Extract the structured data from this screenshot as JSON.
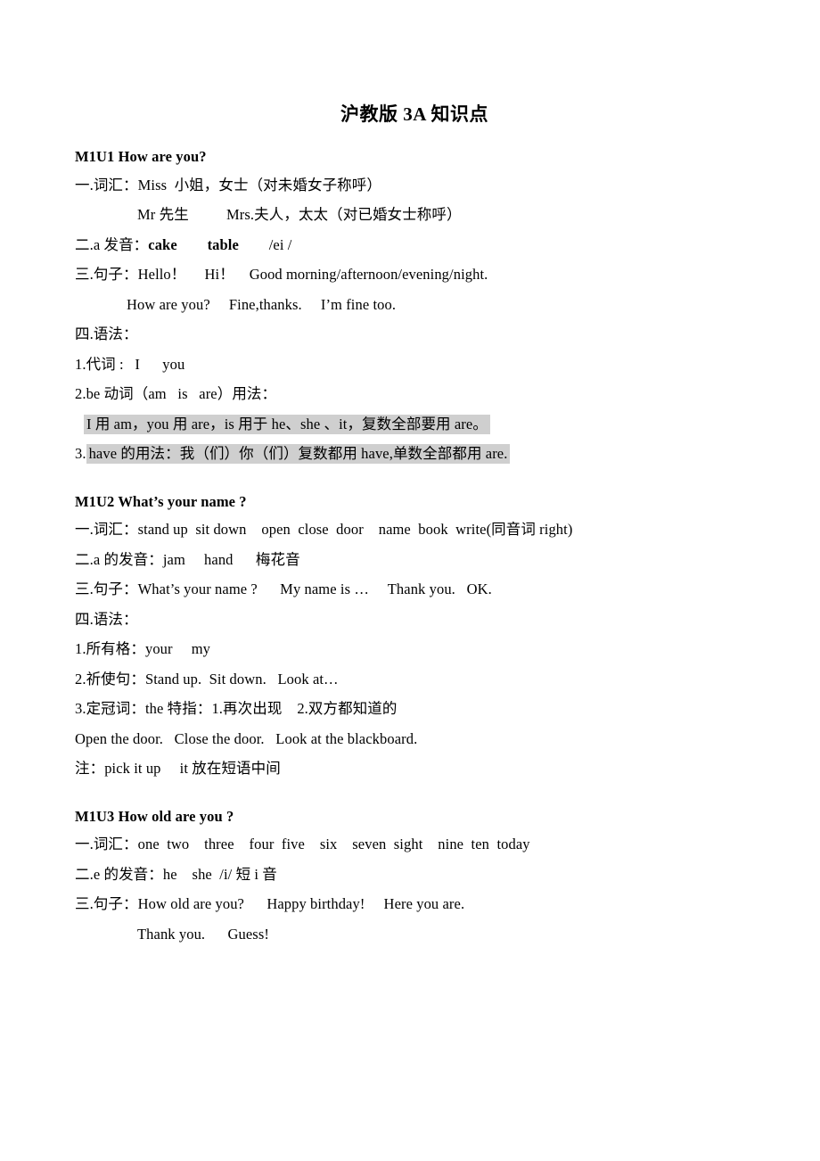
{
  "document": {
    "title": "沪教版 3A 知识点"
  },
  "sections": [
    {
      "id": "m1u1",
      "heading": "M1U1    How are you?",
      "lines": [
        {
          "id": "l1",
          "text": "一.词汇：Miss  小姐，女士（对未婚女子称呼）"
        },
        {
          "id": "l2",
          "text": "Mr 先生          Mrs.夫人，太太（对已婚女士称呼）"
        },
        {
          "id": "l3_pre",
          "text": "二.a 发音："
        },
        {
          "id": "l3_b1",
          "text": "cake"
        },
        {
          "id": "l3_mid",
          "text": "        "
        },
        {
          "id": "l3_b2",
          "text": "table"
        },
        {
          "id": "l3_end",
          "text": "        /ei /"
        },
        {
          "id": "l4",
          "text": "三.句子：Hello！     Hi！    Good morning/afternoon/evening/night."
        },
        {
          "id": "l5",
          "text": "How are you?     Fine,thanks.     I’m fine too."
        },
        {
          "id": "l6",
          "text": "四.语法："
        },
        {
          "id": "l7",
          "text": "1.代词 :   I      you"
        },
        {
          "id": "l8",
          "text": "2.be 动词（am   is   are）用法："
        },
        {
          "id": "l9",
          "text": "I 用 am，you 用 are，is 用于 he、she 、it，复数全部要用 are。"
        },
        {
          "id": "l10_num",
          "text": "3."
        },
        {
          "id": "l10_hl",
          "text": "have 的用法：我（们）你（们）复数都用 have,单数全部都用 are."
        }
      ]
    },
    {
      "id": "m1u2",
      "heading": "M1U2 What’s your name ?",
      "lines": [
        {
          "id": "l1",
          "text": "一.词汇：stand up  sit down    open  close  door    name  book  write(同音词 right)"
        },
        {
          "id": "l2",
          "text": "二.a 的发音：jam     hand      梅花音"
        },
        {
          "id": "l3",
          "text": "三.句子：What’s your name ?      My name is …     Thank you.   OK."
        },
        {
          "id": "l4",
          "text": "四.语法："
        },
        {
          "id": "l5",
          "text": "1.所有格：your     my"
        },
        {
          "id": "l6",
          "text": "2.祈使句：Stand up.  Sit down.   Look at…"
        },
        {
          "id": "l7",
          "text": "3.定冠词：the 特指：1.再次出现    2.双方都知道的"
        },
        {
          "id": "l8",
          "text": "Open the door.   Close the door.   Look at the blackboard."
        },
        {
          "id": "l9",
          "text": "注：pick it up     it 放在短语中间"
        }
      ]
    },
    {
      "id": "m1u3",
      "heading": "M1U3 How old are you ?",
      "lines": [
        {
          "id": "l1",
          "text": "一.词汇：one  two    three    four  five    six    seven  sight    nine  ten  today"
        },
        {
          "id": "l2",
          "text": "二.e 的发音：he    she  /i/ 短 i 音"
        },
        {
          "id": "l3",
          "text": "三.句子：How old are you?      Happy birthday!     Here you are."
        },
        {
          "id": "l4",
          "text": "Thank you.      Guess!"
        }
      ]
    }
  ],
  "colors": {
    "text": "#000000",
    "page_background": "#ffffff",
    "highlight": "#cfcfcf"
  }
}
